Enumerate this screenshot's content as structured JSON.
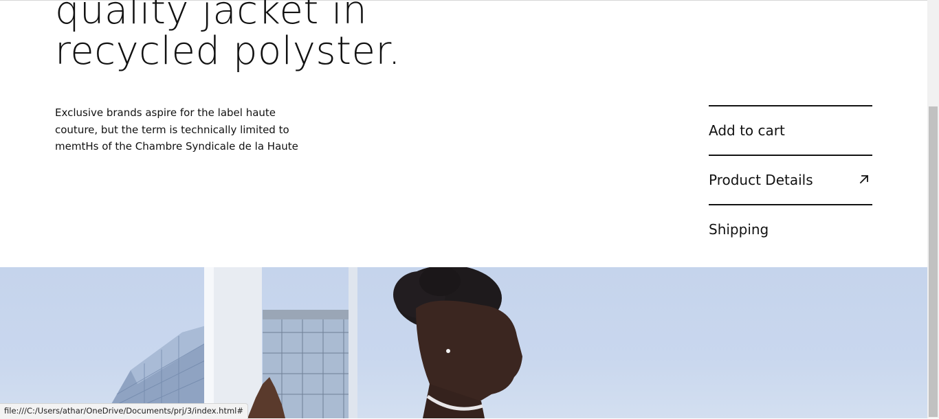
{
  "headline": {
    "line1": "quality jacket in",
    "line2": "recycled polyster."
  },
  "description": {
    "line1": "Exclusive brands aspire for the label haute",
    "line2": "couture, but the term is technically limited to",
    "line3": "memtHs of the Chambre Syndicale de la Haute"
  },
  "actions": {
    "add_to_cart": "Add to cart",
    "product_details": "Product Details",
    "shipping": "Shipping"
  },
  "icons": {
    "product_details_icon": "arrow-up-right-icon"
  },
  "status_bar": {
    "url": "file:///C:/Users/athar/OneDrive/Documents/prj/3/index.html#"
  },
  "colors": {
    "text": "#111111",
    "sky": "#c6d5ec"
  }
}
